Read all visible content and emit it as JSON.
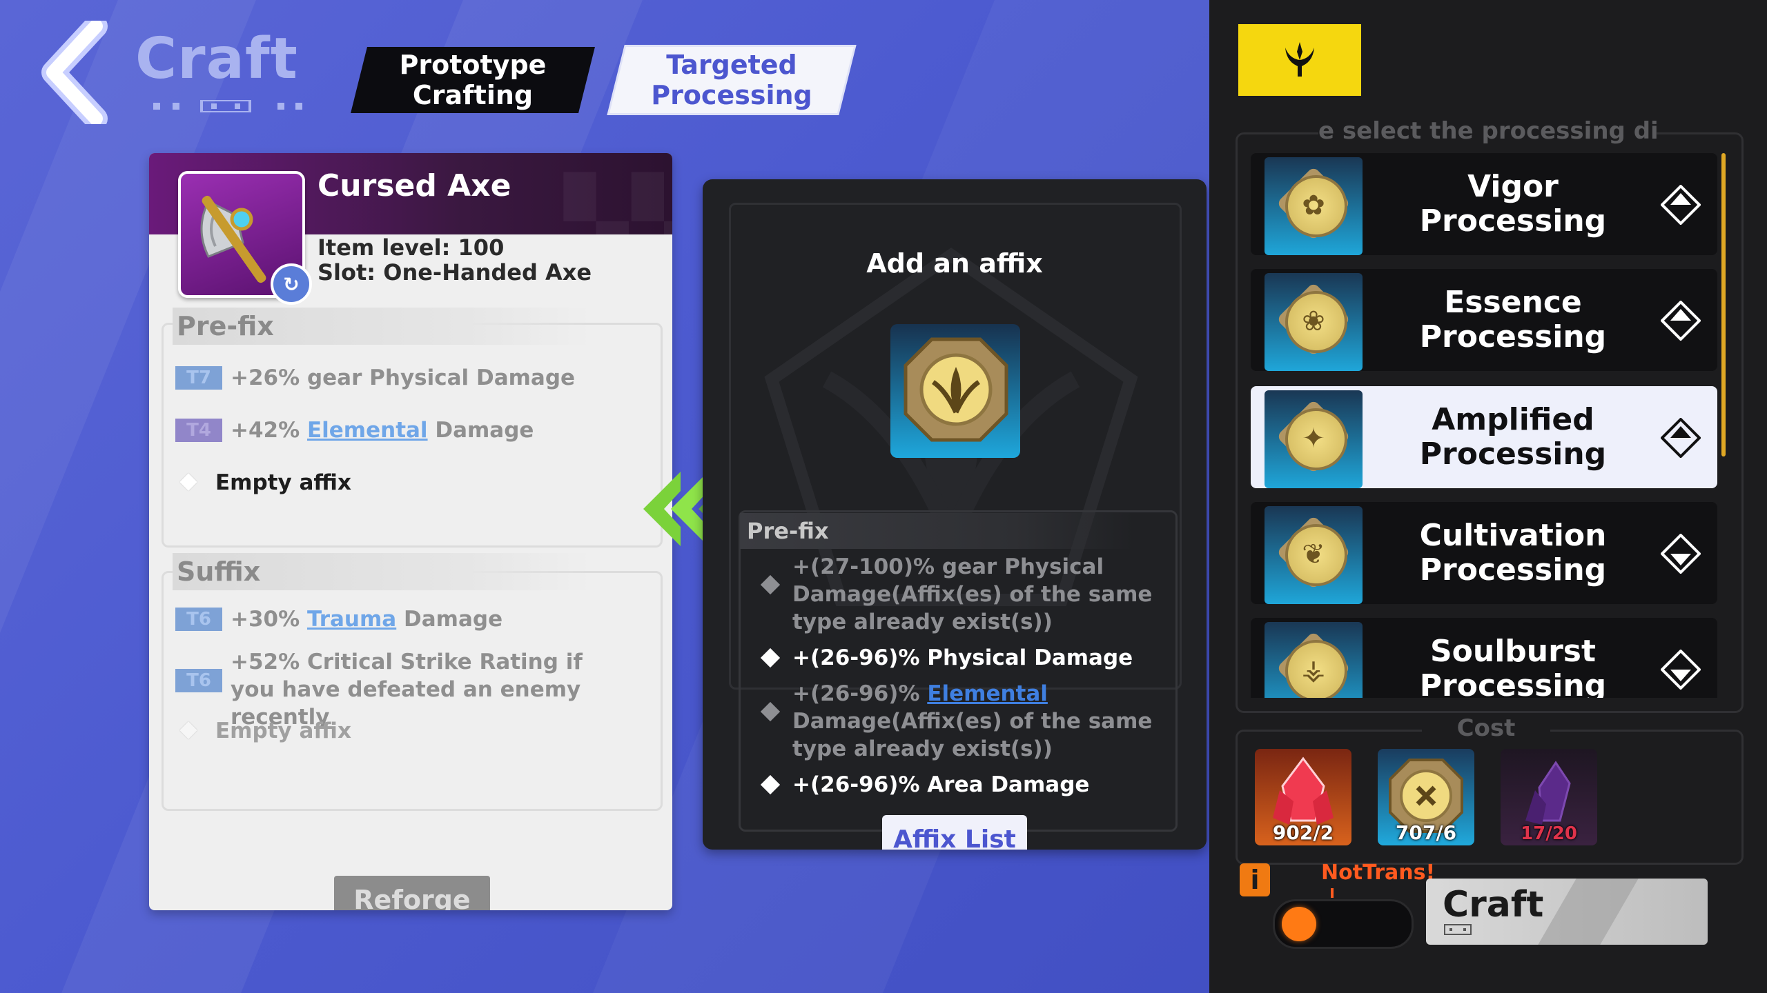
{
  "header": {
    "title": "Craft",
    "tabs": [
      {
        "label": "Prototype\nCrafting",
        "active": false
      },
      {
        "label": "Targeted\nProcessing",
        "active": true
      }
    ]
  },
  "item": {
    "name": "Cursed Axe",
    "level_text": "Item level: 100",
    "slot_text": "Slot: One-Handed Axe",
    "prefix_title": "Pre-fix",
    "prefixes": [
      {
        "tier": "T7",
        "pre": "+26% gear Physical Damage",
        "link": "",
        "post": ""
      },
      {
        "tier": "T4",
        "pre": "+42% ",
        "link": "Elemental",
        "post": " Damage"
      },
      {
        "tier": "",
        "pre": "Empty affix",
        "link": "",
        "post": ""
      }
    ],
    "suffix_title": "Suffix",
    "suffixes": [
      {
        "tier": "T6",
        "pre": "+30% ",
        "link": "Trauma",
        "post": " Damage"
      },
      {
        "tier": "T6",
        "pre": "+52% Critical Strike Rating if you have defeated an enemy recently",
        "link": "",
        "post": ""
      },
      {
        "tier": "",
        "pre": "Empty affix",
        "link": "",
        "post": ""
      }
    ],
    "reforge_label": "Reforge"
  },
  "affix_panel": {
    "title": "Add an affix",
    "list_title": "Pre-fix",
    "options": [
      {
        "pre": "+(27-100)% gear Physical Damage(Affix(es) of the same type already exist(s))",
        "link": "",
        "post": "",
        "available": false
      },
      {
        "pre": "+(26-96)% Physical Damage",
        "link": "",
        "post": "",
        "available": true
      },
      {
        "pre": "+(26-96)% ",
        "link": "Elemental",
        "post": " Damage(Affix(es) of the same type already exist(s))",
        "available": false
      },
      {
        "pre": "+(26-96)% Area Damage",
        "link": "",
        "post": "",
        "available": true
      }
    ],
    "list_button": "Affix List"
  },
  "processing": {
    "hint": "e select the processing dire",
    "options": [
      {
        "name": "Vigor Processing",
        "glyph": "✿",
        "selected": false
      },
      {
        "name": "Essence Processing",
        "glyph": "❀",
        "selected": false
      },
      {
        "name": "Amplified Processing",
        "glyph": "✦",
        "selected": true
      },
      {
        "name": "Cultivation Processing",
        "glyph": "❦",
        "selected": false
      },
      {
        "name": "Soulburst Processing",
        "glyph": "⚶",
        "selected": false
      }
    ]
  },
  "cost": {
    "title": "Cost",
    "items": [
      {
        "qty": "902/2",
        "icon": "red-crystal-icon"
      },
      {
        "qty": "707/6",
        "icon": "processing-token-icon"
      },
      {
        "qty": "17/20",
        "icon": "purple-crystal-icon"
      }
    ]
  },
  "footer": {
    "warning": "NotTrans!",
    "craft_label": "Craft"
  },
  "colors": {
    "accent": "#f5d70f",
    "link": "#6fa6e8",
    "tab_active_text": "#4c56cf",
    "warning": "#ff5a1f"
  }
}
